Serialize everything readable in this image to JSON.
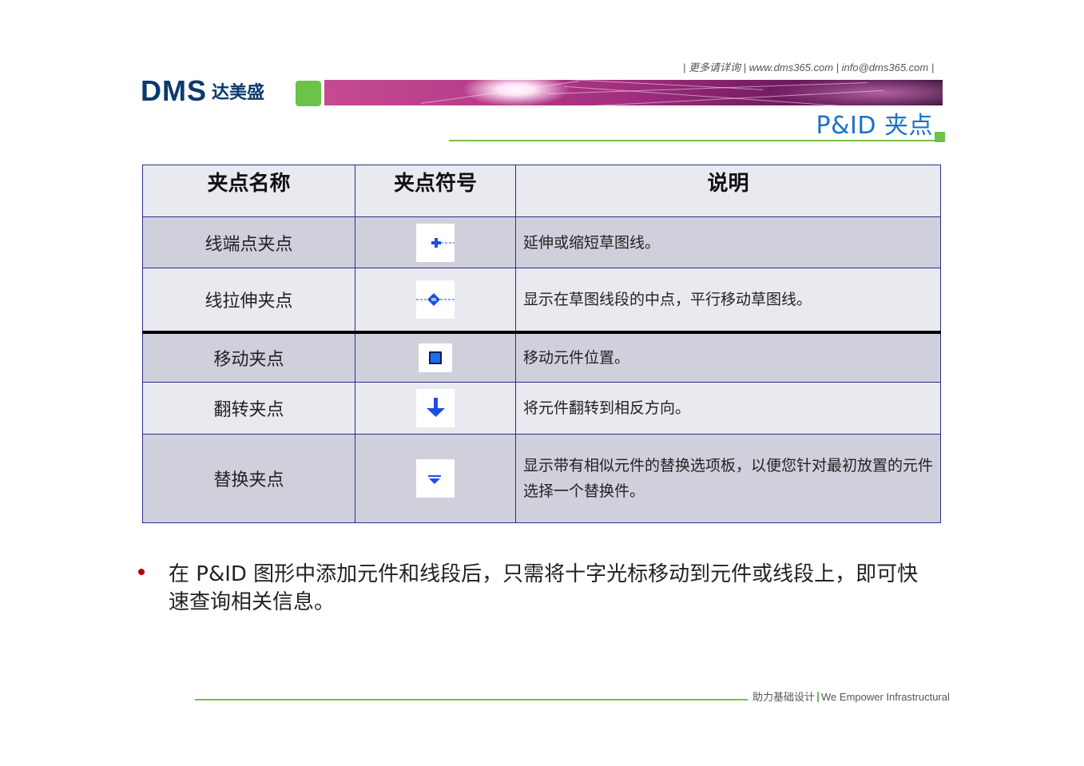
{
  "header": {
    "contact": "| 更多请详询 | www.dms365.com | info@dms365.com |",
    "logo_latin": "DMS",
    "logo_cn": "达美盛"
  },
  "page_title": "P&ID 夹点",
  "table": {
    "headers": [
      "夹点名称",
      "夹点符号",
      "说明"
    ],
    "rows": [
      {
        "name": "线端点夹点",
        "symbol_icon": "endpoint-grip-icon",
        "desc": "延伸或缩短草图线。"
      },
      {
        "name": "线拉伸夹点",
        "symbol_icon": "stretch-grip-icon",
        "desc": "显示在草图线段的中点，平行移动草图线。"
      },
      {
        "name": "移动夹点",
        "symbol_icon": "move-grip-icon",
        "desc": "移动元件位置。"
      },
      {
        "name": "翻转夹点",
        "symbol_icon": "flip-grip-icon",
        "desc": "将元件翻转到相反方向。"
      },
      {
        "name": "替换夹点",
        "symbol_icon": "substitute-grip-icon",
        "desc": "显示带有相似元件的替换选项板，以便您针对最初放置的元件选择一个替换件。"
      }
    ]
  },
  "bullet": "在 P&ID 图形中添加元件和线段后，只需将十字光标移动到元件或线段上，即可快速查询相关信息。",
  "footer": {
    "cn": "助力基础设计",
    "en": "We Empower Infrastructural"
  },
  "colors": {
    "brand_blue": "#0b3a6e",
    "title_blue": "#1a73c8",
    "accent_green": "#6cc24a",
    "table_border": "#2b2f8f",
    "grip_blue": "#1f4fe0"
  }
}
